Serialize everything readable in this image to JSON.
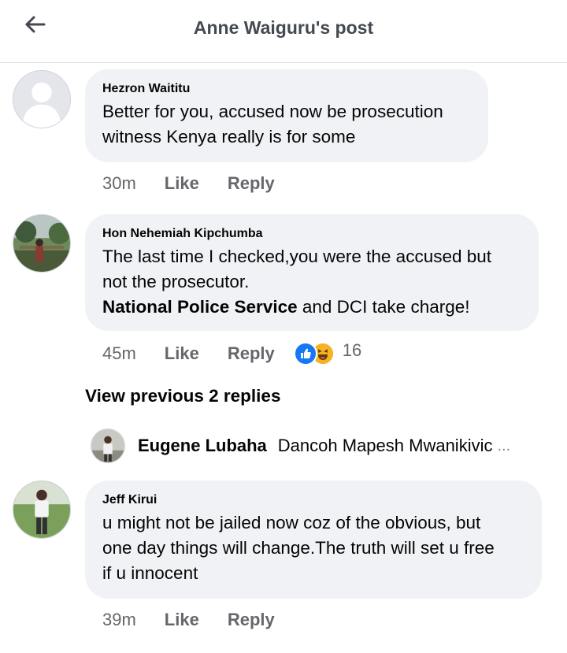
{
  "header": {
    "title": "Anne Waiguru's post",
    "back_icon": "arrow-left-icon"
  },
  "comments": [
    {
      "author": "Hezron Waititu",
      "text_lines": [
        "Better for you, accused now be prosecution",
        "witness Kenya really is for some"
      ],
      "time": "30m",
      "like_label": "Like",
      "reply_label": "Reply",
      "avatar": "default-profile-avatar"
    },
    {
      "author": "Hon Nehemiah Kipchumba",
      "text_lines": [
        "The last time I checked,you were the accused but",
        "not the prosecutor."
      ],
      "mention": "National Police Service",
      "mention_tail": " and DCI take charge!",
      "time": "45m",
      "like_label": "Like",
      "reply_label": "Reply",
      "reaction_count": "16",
      "reaction_icons": [
        "like-reaction-icon",
        "haha-reaction-icon"
      ],
      "avatar": "photo-avatar"
    },
    {
      "author": "Jeff Kirui",
      "text_lines": [
        "u might not be jailed now coz of the obvious, but",
        "one day things will change.The truth will set u free",
        "if u innocent"
      ],
      "time": "39m",
      "like_label": "Like",
      "reply_label": "Reply",
      "avatar": "photo-avatar"
    }
  ],
  "view_previous": "View previous 2 replies",
  "reply_preview": {
    "author": "Eugene Lubaha",
    "text": "Dancoh Mapesh Mwanikivic",
    "more": "..."
  },
  "colors": {
    "bubble": "#f0f2f5",
    "secondary_text": "#65676b",
    "like_blue": "#1877f2",
    "haha_yellow": "#f7b125"
  }
}
